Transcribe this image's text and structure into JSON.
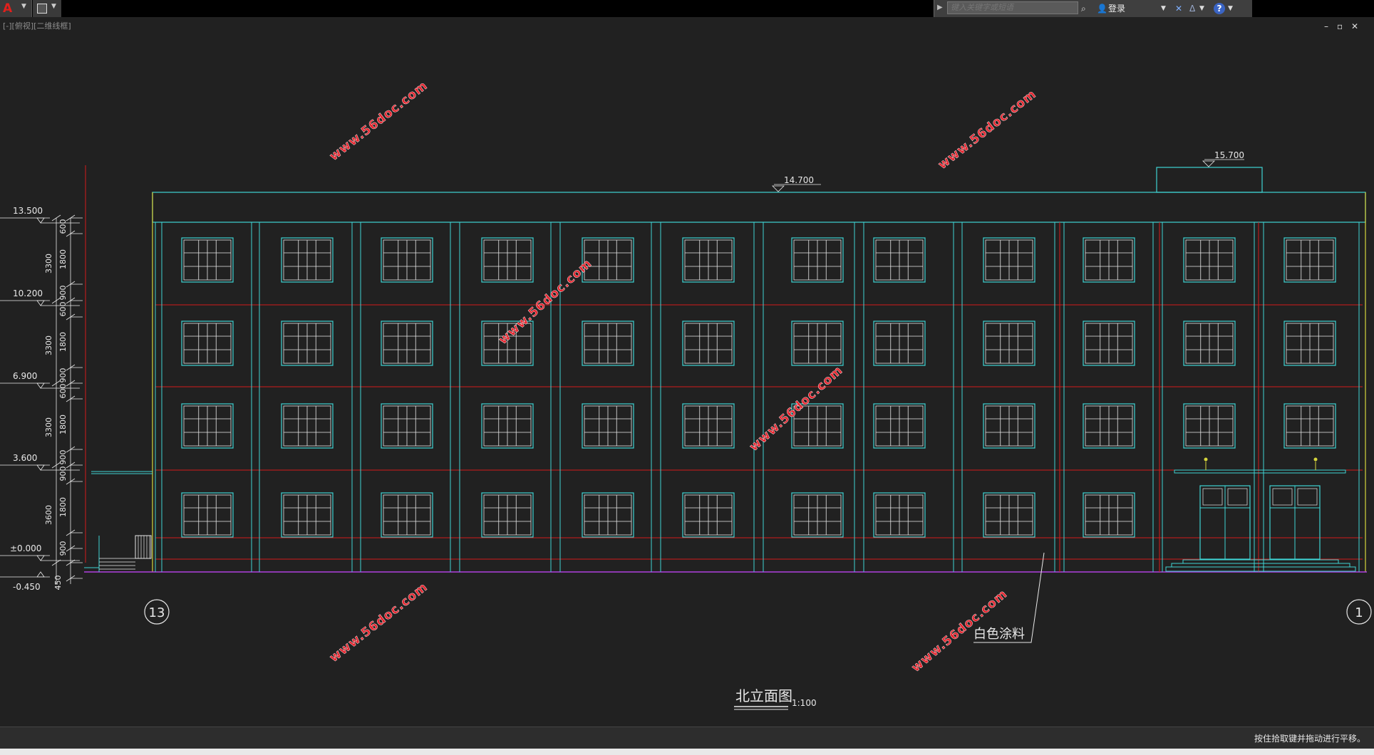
{
  "app": {
    "logo_glyph": "A"
  },
  "infocenter": {
    "search_placeholder": "键入关键字或短语",
    "login_label": "登录",
    "binoculars_icon": "binoculars-icon",
    "user_icon": "user-icon",
    "exchange_icon": "exchange-icon",
    "a360_icon": "a360-icon",
    "help_icon": "help-icon"
  },
  "viewport": {
    "label": "[-][俯视][二维线框]"
  },
  "window_controls": {
    "minimize": "–",
    "restore": "▫",
    "close": "✕"
  },
  "drawing": {
    "watermarks": [
      "www.56doc.com",
      "www.56doc.com",
      "www.56doc.com",
      "www.56doc.com",
      "www.56doc.com",
      "www.56doc.com",
      "www.56doc.com"
    ],
    "level_labels": [
      "13.500",
      "10.200",
      "6.900",
      "3.600",
      "±0.000",
      "-0.450"
    ],
    "vertical_dimensions": [
      "600",
      "1800",
      "3300",
      "900",
      "600",
      "1800",
      "3300",
      "900",
      "600",
      "1800",
      "3300",
      "900",
      "900",
      "1800",
      "3600",
      "900",
      "450"
    ],
    "roof_level": "14.700",
    "stair_level": "15.700",
    "axis_left": "13",
    "axis_right": "1",
    "material_note": "白色涂料",
    "title": "北立面图",
    "scale": "1:100"
  },
  "colors": {
    "cyan": "#3fd4d4",
    "red": "#d21a1a",
    "white": "#e8e8e8",
    "yellow": "#d6d63c",
    "magenta": "#b040e0",
    "watermark": "#e8232d"
  },
  "status": {
    "message": "按住拾取键并拖动进行平移。"
  }
}
